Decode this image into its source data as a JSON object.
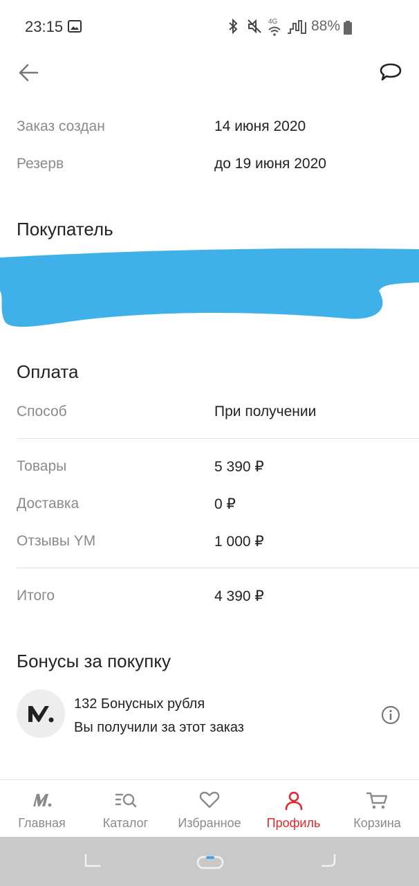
{
  "status_bar": {
    "time": "23:15",
    "battery": "88%",
    "network": "4G",
    "icons": [
      "image-icon",
      "bluetooth-icon",
      "mute-icon",
      "wifi-icon",
      "signal-icon",
      "battery-icon"
    ]
  },
  "header": {
    "back_icon": "arrow-left-icon",
    "chat_icon": "chat-bubble-icon"
  },
  "order": {
    "created_label": "Заказ создан",
    "created_value": "14 июня 2020",
    "reserve_label": "Резерв",
    "reserve_value": "до 19 июня 2020"
  },
  "buyer": {
    "title": "Покупатель"
  },
  "payment": {
    "title": "Оплата",
    "method_label": "Способ",
    "method_value": "При получении",
    "goods_label": "Товары",
    "goods_value": "5 390 ₽",
    "delivery_label": "Доставка",
    "delivery_value": "0 ₽",
    "reviews_label": "Отзывы YM",
    "reviews_value": "1 000 ₽",
    "total_label": "Итого",
    "total_value": "4 390 ₽"
  },
  "bonuses": {
    "title": "Бонусы за покупку",
    "amount_text": "132 Бонусных рубля",
    "description": "Вы получили за этот заказ"
  },
  "bottom_nav": {
    "items": [
      {
        "label": "Главная",
        "icon": "market-logo-icon",
        "active": false
      },
      {
        "label": "Каталог",
        "icon": "catalog-search-icon",
        "active": false
      },
      {
        "label": "Избранное",
        "icon": "heart-icon",
        "active": false
      },
      {
        "label": "Профиль",
        "icon": "profile-icon",
        "active": true
      },
      {
        "label": "Корзина",
        "icon": "cart-icon",
        "active": false
      }
    ]
  },
  "colors": {
    "accent": "#e5252f",
    "muted": "#8a8a8a",
    "redaction": "#3fb1e8",
    "system_nav": "#c9c9c9"
  }
}
